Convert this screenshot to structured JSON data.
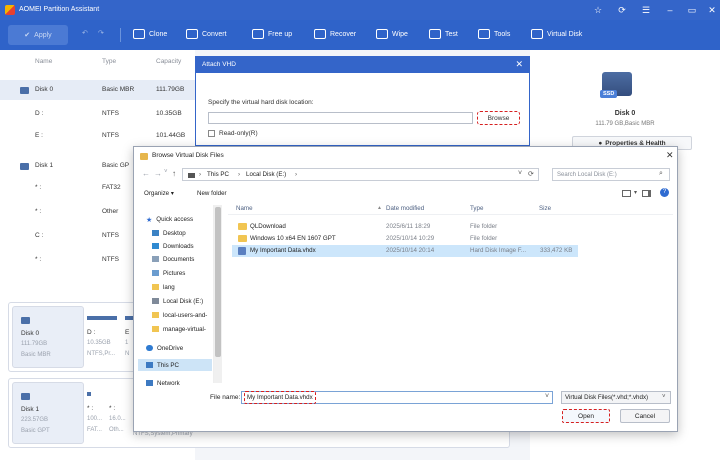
{
  "app": {
    "title": "AOMEI Partition Assistant"
  },
  "toolbar": {
    "apply_label": "Apply",
    "items": [
      {
        "label": "Clone",
        "icon": "clone-icon"
      },
      {
        "label": "Convert",
        "icon": "convert-icon"
      },
      {
        "label": "Free up",
        "icon": "free-up-icon"
      },
      {
        "label": "Recover",
        "icon": "recover-icon"
      },
      {
        "label": "Wipe",
        "icon": "wipe-icon"
      },
      {
        "label": "Test",
        "icon": "test-icon"
      },
      {
        "label": "Tools",
        "icon": "tools-icon"
      },
      {
        "label": "Virtual Disk",
        "icon": "virtual-disk-icon"
      }
    ]
  },
  "disk_list": {
    "headers": [
      "Name",
      "Type",
      "Capacity"
    ],
    "rows": [
      {
        "name": "Disk 0",
        "type": "Basic MBR",
        "capacity": "111.79GB"
      },
      {
        "name": "D :",
        "type": "NTFS",
        "capacity": "10.35GB"
      },
      {
        "name": "E :",
        "type": "NTFS",
        "capacity": "101.44GB"
      },
      {
        "name": "Disk 1",
        "type": "Basic GP",
        "capacity": ""
      },
      {
        "name": "* :",
        "type": "FAT32",
        "capacity": ""
      },
      {
        "name": "* :",
        "type": "Other",
        "capacity": ""
      },
      {
        "name": "C :",
        "type": "NTFS",
        "capacity": ""
      },
      {
        "name": "* :",
        "type": "NTFS",
        "capacity": ""
      }
    ]
  },
  "disk_cards": [
    {
      "name": "Disk 0",
      "size": "111.79GB",
      "type": "Basic MBR",
      "p1": "D :",
      "p1s": "10.35GB",
      "p1f": "NTFS,Pr...",
      "p2": "E",
      "p2s": "1",
      "p2f": "N"
    },
    {
      "name": "Disk 1",
      "size": "223.57GB",
      "type": "Basic GPT",
      "p1": "* :",
      "p1s": "100...",
      "p1f": "FAT...",
      "p2": "* :",
      "p2s": "16.0...",
      "p2f": "Oth...",
      "p3f": "NTFS,System,Primary"
    }
  ],
  "right_panel": {
    "disk_label": "Disk 0",
    "disk_info": "111.79 GB,Basic MBR",
    "badge": "SSD",
    "properties_label": "Properties & Health"
  },
  "attach_dialog": {
    "title": "Attach VHD",
    "prompt": "Specify the virtual hard disk location:",
    "browse_label": "Browse",
    "readonly_label": "Read-only(R)"
  },
  "file_dialog": {
    "title": "Browse Virtual Disk Files",
    "breadcrumb": [
      "This PC",
      "Local Disk (E:)"
    ],
    "search_placeholder": "Search Local Disk (E:)",
    "organize_label": "Organize",
    "new_folder_label": "New folder",
    "nav_items": [
      {
        "label": "Quick access",
        "icon": "star-icon"
      },
      {
        "label": "Desktop",
        "icon": "desktop-icon"
      },
      {
        "label": "Downloads",
        "icon": "downloads-icon"
      },
      {
        "label": "Documents",
        "icon": "documents-icon"
      },
      {
        "label": "Pictures",
        "icon": "pictures-icon"
      },
      {
        "label": "lang",
        "icon": "folder-icon"
      },
      {
        "label": "Local Disk (E:)",
        "icon": "drive-icon"
      },
      {
        "label": "local-users-and-",
        "icon": "folder-icon"
      },
      {
        "label": "manage-virtual-",
        "icon": "folder-icon"
      },
      {
        "label": "OneDrive",
        "icon": "onedrive-icon"
      },
      {
        "label": "This PC",
        "icon": "pc-icon"
      },
      {
        "label": "Network",
        "icon": "network-icon"
      }
    ],
    "columns": [
      "Name",
      "Date modified",
      "Type",
      "Size"
    ],
    "files": [
      {
        "name": "QLDownload",
        "date": "2025/6/11 18:29",
        "type": "File folder",
        "size": "",
        "kind": "folder"
      },
      {
        "name": "Windows 10 x64 EN 1607 GPT",
        "date": "2025/10/14 10:29",
        "type": "File folder",
        "size": "",
        "kind": "folder"
      },
      {
        "name": "My Important Data.vhdx",
        "date": "2025/10/14 20:14",
        "type": "Hard Disk Image F...",
        "size": "333,472 KB",
        "kind": "vhd"
      }
    ],
    "filename_label": "File name:",
    "filename_value": "My Important Data.vhdx",
    "filetype_value": "Virtual Disk Files(*.vhd;*.vhdx)",
    "open_label": "Open",
    "cancel_label": "Cancel"
  },
  "colors": {
    "titlebar": "#3465c9",
    "toolbar": "#2f63c9",
    "highlight": "#d62020",
    "selection": "#cce6fb"
  }
}
